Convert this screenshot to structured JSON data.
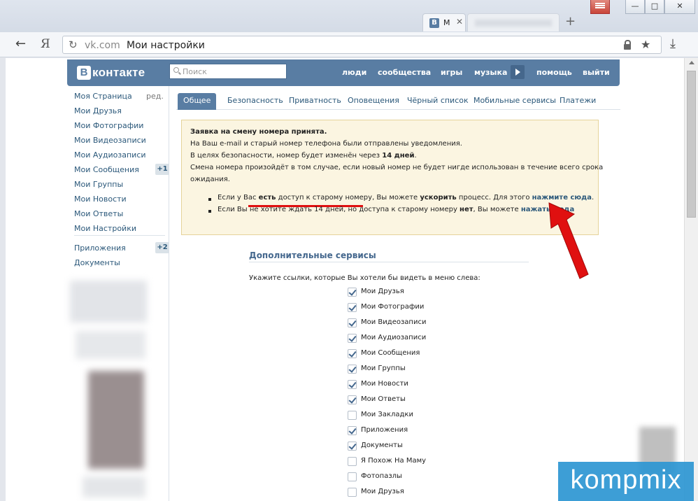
{
  "browser": {
    "tab_title": "М",
    "tab_favicon": "В",
    "new_tab_label": "+",
    "back_glyph": "←",
    "ya_label": "Я",
    "url_domain": "vk.com",
    "url_title": "Мои настройки",
    "win_min": "—",
    "win_max": "□",
    "win_close": "✕"
  },
  "vk": {
    "logo_letter": "В",
    "logo_text": "контакте",
    "search_placeholder": "Поиск",
    "nav": [
      "люди",
      "сообщества",
      "игры",
      "музыка",
      "помощь",
      "выйти"
    ]
  },
  "left_menu": {
    "items": [
      {
        "label": "Моя Страница",
        "extra": "ред."
      },
      {
        "label": "Мои Друзья"
      },
      {
        "label": "Мои Фотографии"
      },
      {
        "label": "Мои Видеозаписи"
      },
      {
        "label": "Мои Аудиозаписи"
      },
      {
        "label": "Мои Сообщения",
        "badge": "+1"
      },
      {
        "label": "Мои Группы"
      },
      {
        "label": "Мои Новости"
      },
      {
        "label": "Мои Ответы"
      },
      {
        "label": "Мои Настройки"
      },
      {
        "label": "Приложения",
        "badge": "+2"
      },
      {
        "label": "Документы"
      }
    ]
  },
  "tabs": [
    "Общее",
    "Безопасность",
    "Приватность",
    "Оповещения",
    "Чёрный список",
    "Мобильные сервисы",
    "Платежи"
  ],
  "notice": {
    "title": "Заявка на смену номера принята.",
    "line1": "На Ваш e-mail и старый номер телефона были отправлены уведомления.",
    "line2_pre": "В целях безопасности, номер будет изменён через ",
    "line2_bold": "14 дней",
    "line2_post": ".",
    "line3": "Смена номера произойдёт в том случае, если новый номер не будет нигде использован в течение всего срока",
    "line4": "ожидания.",
    "b1_a": "Если у Вас ",
    "b1_b": "есть",
    "b1_c": " доступ к старому номеру",
    "b1_d": ", Вы можете ",
    "b1_e": "ускорить",
    "b1_f": " процесс. Для этого ",
    "b1_link": "нажмите сюда",
    "b1_end": ".",
    "b2_a": "Если Вы не хотите ждать 14 дней, но доступа к старому номеру ",
    "b2_b": "нет",
    "b2_c": ", Вы можете ",
    "b2_link": "нажать сюда"
  },
  "services": {
    "title": "Дополнительные сервисы",
    "hint": "Укажите ссылки, которые Вы хотели бы видеть в меню слева:",
    "items": [
      {
        "label": "Мои Друзья",
        "checked": true
      },
      {
        "label": "Мои Фотографии",
        "checked": true
      },
      {
        "label": "Мои Видеозаписи",
        "checked": true
      },
      {
        "label": "Мои Аудиозаписи",
        "checked": true
      },
      {
        "label": "Мои Сообщения",
        "checked": true
      },
      {
        "label": "Мои Группы",
        "checked": true
      },
      {
        "label": "Мои Новости",
        "checked": true
      },
      {
        "label": "Мои Ответы",
        "checked": true
      },
      {
        "label": "Мои Закладки",
        "checked": false
      },
      {
        "label": "Приложения",
        "checked": true
      },
      {
        "label": "Документы",
        "checked": true
      },
      {
        "label": "Я Похож На Маму",
        "checked": false
      },
      {
        "label": "Фотопазлы",
        "checked": false
      },
      {
        "label": "Мои Друзья",
        "checked": false
      }
    ]
  },
  "watermark": "kompmix",
  "colors": {
    "vk_blue": "#597da3",
    "link": "#2b587a",
    "arrow_red": "#e01010",
    "notice_bg": "#fbf5e1"
  }
}
